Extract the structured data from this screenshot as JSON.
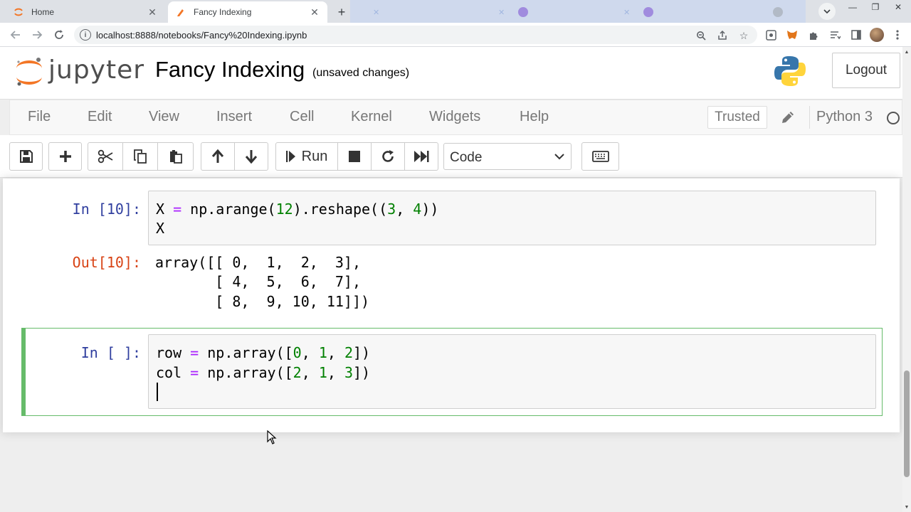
{
  "browser": {
    "tabs": [
      {
        "title": "Home",
        "close": "✕",
        "icon": "jupyter-favicon"
      },
      {
        "title": "Fancy Indexing",
        "close": "✕",
        "icon": "jupyter-notebook-favicon"
      }
    ],
    "new_tab": "+",
    "url": "localhost:8888/notebooks/Fancy%20Indexing.ipynb"
  },
  "header": {
    "logo_text": "jupyter",
    "notebook_title": "Fancy Indexing",
    "save_status": "(unsaved changes)",
    "logout_label": "Logout"
  },
  "menu": {
    "items": [
      "File",
      "Edit",
      "View",
      "Insert",
      "Cell",
      "Kernel",
      "Widgets",
      "Help"
    ],
    "trusted_label": "Trusted",
    "kernel_name": "Python 3"
  },
  "toolbar": {
    "run_label": "Run",
    "cell_type": "Code",
    "buttons": [
      "save-icon",
      "plus-icon",
      "scissors-icon",
      "copy-icon",
      "paste-icon",
      "arrow-up-icon",
      "arrow-down-icon",
      "run-icon",
      "stop-icon",
      "restart-icon",
      "fast-forward-icon",
      "keyboard-icon"
    ]
  },
  "cells": [
    {
      "prompt": "In [10]:",
      "code": [
        "X = np.arange(12).reshape((3, 4))",
        "X"
      ],
      "output_prompt": "Out[10]:",
      "output": [
        "array([[ 0,  1,  2,  3],",
        "       [ 4,  5,  6,  7],",
        "       [ 8,  9, 10, 11]])"
      ]
    },
    {
      "prompt": "In [ ]:",
      "code": [
        "row = np.array([0, 1, 2])",
        "col = np.array([2, 1, 3])",
        ""
      ]
    }
  ],
  "colors": {
    "in_prompt": "#303f9f",
    "out_prompt": "#d84315",
    "selected_cell_border": "#66bb6a",
    "code_operator": "#aa22ff",
    "code_number": "#008000"
  }
}
